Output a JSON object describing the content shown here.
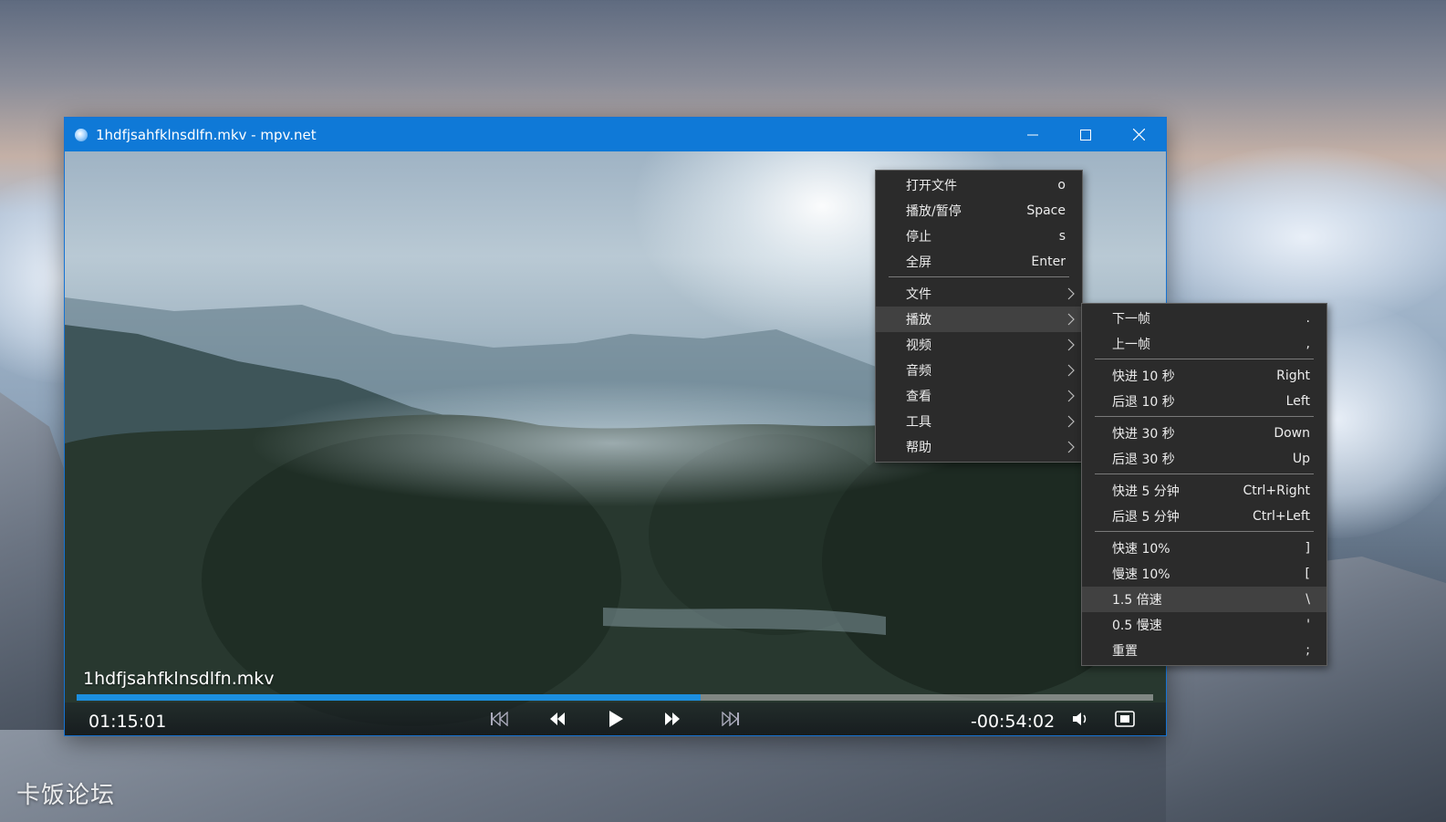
{
  "window": {
    "title": "1hdfjsahfklnsdlfn.mkv - mpv.net"
  },
  "player": {
    "filename": "1hdfjsahfklnsdlfn.mkv",
    "elapsed": "01:15:01",
    "remaining": "-00:54:02",
    "progress_fraction": 0.58
  },
  "context_menu": {
    "items": [
      {
        "label": "打开文件",
        "shortcut": "o"
      },
      {
        "label": "播放/暂停",
        "shortcut": "Space"
      },
      {
        "label": "停止",
        "shortcut": "s"
      },
      {
        "label": "全屏",
        "shortcut": "Enter"
      },
      {
        "label": "文件"
      },
      {
        "label": "播放"
      },
      {
        "label": "视频"
      },
      {
        "label": "音频"
      },
      {
        "label": "查看"
      },
      {
        "label": "工具"
      },
      {
        "label": "帮助"
      }
    ]
  },
  "submenu": {
    "items": [
      {
        "label": "下一帧",
        "shortcut": "."
      },
      {
        "label": "上一帧",
        "shortcut": ","
      },
      {
        "label": "快进 10 秒",
        "shortcut": "Right"
      },
      {
        "label": "后退 10 秒",
        "shortcut": "Left"
      },
      {
        "label": "快进 30 秒",
        "shortcut": "Down"
      },
      {
        "label": "后退 30 秒",
        "shortcut": "Up"
      },
      {
        "label": "快进 5 分钟",
        "shortcut": "Ctrl+Right"
      },
      {
        "label": "后退 5 分钟",
        "shortcut": "Ctrl+Left"
      },
      {
        "label": "快速 10%",
        "shortcut": "]"
      },
      {
        "label": "慢速 10%",
        "shortcut": "["
      },
      {
        "label": "1.5 倍速",
        "shortcut": "\\"
      },
      {
        "label": "0.5 慢速",
        "shortcut": "'"
      },
      {
        "label": "重置",
        "shortcut": ";"
      }
    ]
  },
  "watermark": "卡饭论坛",
  "colors": {
    "titlebar": "#0f79d7",
    "progress": "#1c8fe0",
    "menu_bg": "#2b2b2b",
    "menu_highlight": "#414141"
  }
}
